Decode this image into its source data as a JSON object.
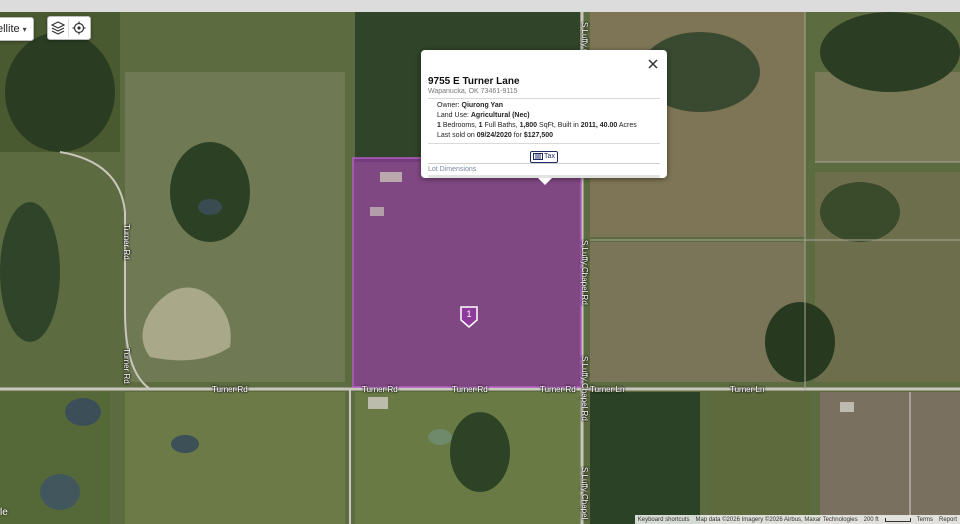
{
  "map": {
    "map_type_label": "ellite",
    "corner_text": "le",
    "layers_icon": "layers-icon",
    "locate_icon": "target-icon",
    "parcel_color": "#8e3a9c",
    "parcel_marker_number": "1"
  },
  "road_labels": {
    "turner_rd_left": "Turner Rd",
    "turner_rd_mid1": "Turner Rd",
    "turner_rd_mid2": "Turner Rd",
    "turner_rd_mid3": "Turner Rd",
    "turner_ln_1": "Turner Ln",
    "turner_ln_2": "Turner Ln",
    "turner_rd_vert_upper": "Turner Rd",
    "turner_rd_vert_lower": "Turner Rd",
    "chapel_top": "S Luffy Chapel",
    "chapel_upper": "S Luffy Chapel Rd",
    "chapel_lower": "S Luffy Chapel Rd",
    "chapel_bottom": "S Luffy Chapel"
  },
  "popup": {
    "title": "9755 E Turner Lane",
    "subtitle": "Wapanucka, OK 73461-9115",
    "owner_label": "Owner:",
    "owner_value": "Qiurong Yan",
    "land_use_label": "Land Use:",
    "land_use_value": "Agricultural (Nec)",
    "beds_value": "1",
    "beds_label": "Bedrooms,",
    "baths_value": "1",
    "baths_label": "Full Baths,",
    "sqft_value": "1,800",
    "sqft_label": "SqFt, Built in",
    "built_value": "2011,",
    "acres_value": "40.00",
    "acres_label": "Acres",
    "sold_label": "Last sold on",
    "sold_date": "09/24/2020",
    "sold_for": "for",
    "sold_price": "$127,500",
    "tax_button_label": "Tax",
    "lot_dimensions_label": "Lot Dimensions",
    "close_icon": "close-icon"
  },
  "attribution": {
    "keyboard": "Keyboard shortcuts",
    "map_data": "Map data ©2026 Imagery ©2026 Airbus, Maxar Technologies",
    "scale": "200 ft",
    "terms": "Terms",
    "report": "Report"
  }
}
